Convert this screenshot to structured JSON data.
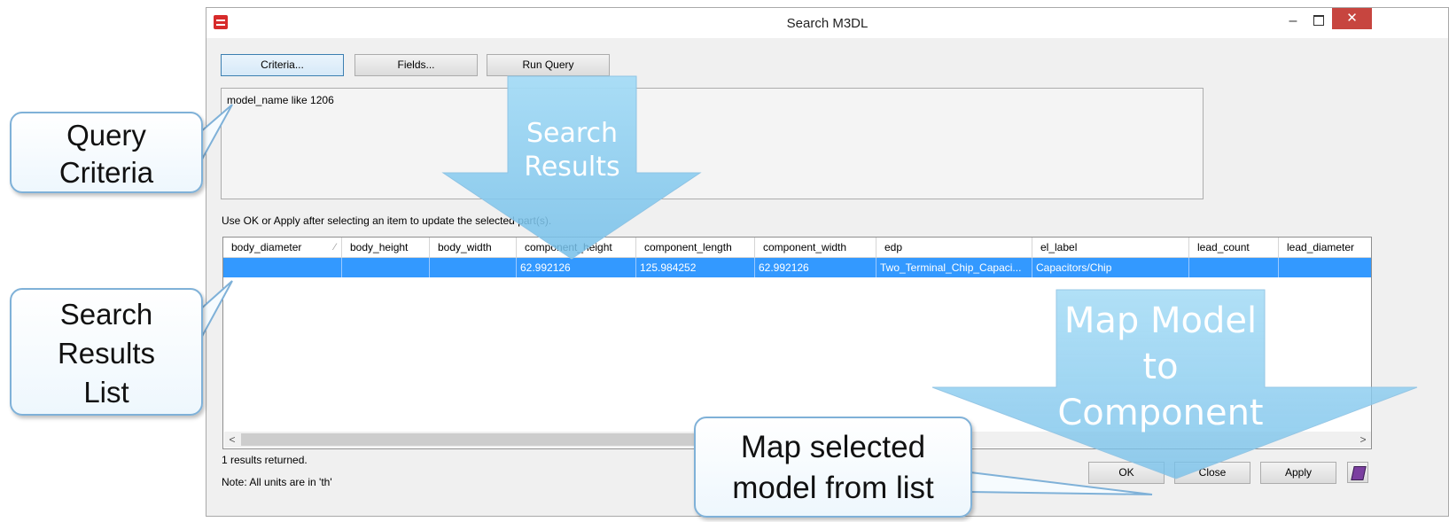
{
  "window": {
    "title": "Search M3DL",
    "min_glyph": "–",
    "close_glyph": "✕"
  },
  "toolbar": {
    "criteria_label": "Criteria...",
    "fields_label": "Fields...",
    "run_query_label": "Run Query"
  },
  "criteria": {
    "text": "model_name like 1206"
  },
  "info_text": "Use OK or Apply after selecting an item to update the selected part(s).",
  "grid": {
    "columns": [
      "body_diameter",
      "body_height",
      "body_width",
      "component_height",
      "component_length",
      "component_width",
      "edp",
      "el_label",
      "lead_count",
      "lead_diameter"
    ],
    "sort_glyph": "⁄",
    "rows": [
      [
        "",
        "",
        "",
        "62.992126",
        "125.984252",
        "62.992126",
        "Two_Terminal_Chip_Capaci...",
        "Capacitors/Chip",
        "",
        ""
      ]
    ],
    "scroll_left_glyph": "<",
    "scroll_right_glyph": ">"
  },
  "status": {
    "results": "1 results returned.",
    "units_note": "Note: All units are in 'th'"
  },
  "buttons": {
    "ok_label": "OK",
    "close_label": "Close",
    "apply_label": "Apply"
  },
  "annotations": {
    "query_criteria": [
      "Query",
      "Criteria"
    ],
    "search_results_list": [
      "Search",
      "Results",
      "List"
    ],
    "search_results_arrow": [
      "Search",
      "Results"
    ],
    "map_model_arrow": [
      "Map Model",
      "to",
      "Component"
    ],
    "map_selected": [
      "Map selected",
      "model from list"
    ]
  },
  "colors": {
    "selection": "#3399ff",
    "close_button": "#c7453f",
    "arrow_fill": "#8fd0f2",
    "callout_border": "#7fb1d8"
  }
}
